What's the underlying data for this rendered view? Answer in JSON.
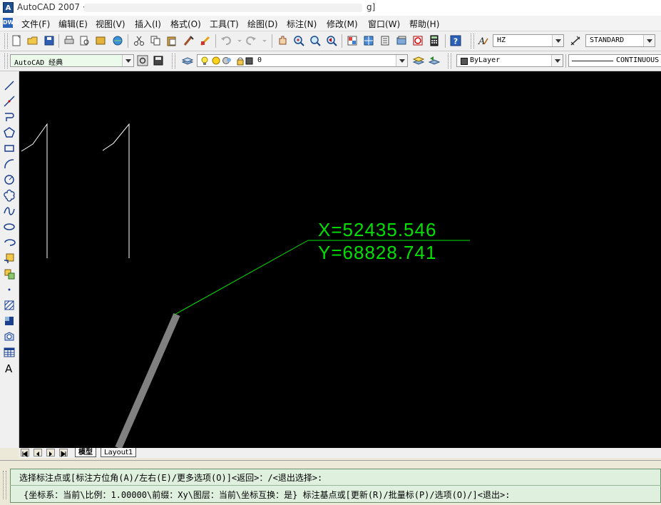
{
  "window": {
    "title": "AutoCAD 2007 ·",
    "title_end": "g]",
    "logo_text": "A"
  },
  "menu": [
    {
      "label": "文件(F)"
    },
    {
      "label": "编辑(E)"
    },
    {
      "label": "视图(V)"
    },
    {
      "label": "插入(I)"
    },
    {
      "label": "格式(O)"
    },
    {
      "label": "工具(T)"
    },
    {
      "label": "绘图(D)"
    },
    {
      "label": "标注(N)"
    },
    {
      "label": "修改(M)"
    },
    {
      "label": "窗口(W)"
    },
    {
      "label": "帮助(H)"
    }
  ],
  "toolbar1": {
    "text_style_value": "HZ",
    "dim_style_value": "STANDARD"
  },
  "toolbar2": {
    "workspace_value": "AutoCAD 经典",
    "layer_value": "0",
    "color_value": "ByLayer",
    "linetype_value": "CONTINUOUS"
  },
  "drawing": {
    "coord_x_label": "X=52435.546",
    "coord_y_label": "Y=68828.741",
    "coord_color": "#00e000",
    "sketch_color": "#ffffff",
    "wall_color": "#808080"
  },
  "layout_tabs": [
    {
      "label": "模型",
      "active": true
    },
    {
      "label": "Layout1",
      "active": false
    }
  ],
  "command": {
    "line1": "选择标注点或[标注方位角(A)/左右(E)/更多选项(O)]<返回>：/<退出选择>:",
    "line2": "{坐标系：当前\\比例：1.00000\\前缀：Xy\\图层：当前\\坐标互换：是} 标注基点或[更新(R)/批量标(P)/选项(O)/]<退出>:"
  },
  "colors": {
    "canvas_bg": "#000000",
    "command_bg": "#dff0df"
  }
}
